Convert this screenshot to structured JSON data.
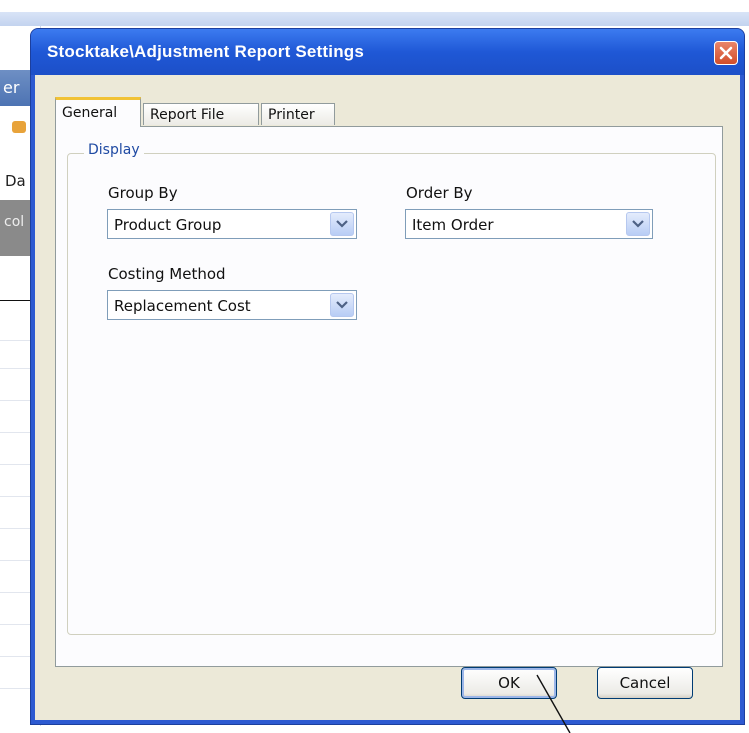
{
  "background_app": {
    "header_fragment": "er",
    "da_fragment": "Da",
    "col_fragment": "col"
  },
  "dialog": {
    "title": "Stocktake\\Adjustment Report Settings",
    "tabs": [
      {
        "label": "General",
        "active": true
      },
      {
        "label": "Report File",
        "active": false
      },
      {
        "label": "Printer",
        "active": false
      }
    ],
    "group_title": "Display",
    "fields": {
      "group_by": {
        "label": "Group By",
        "value": "Product Group"
      },
      "order_by": {
        "label": "Order By",
        "value": "Item Order"
      },
      "costing_method": {
        "label": "Costing Method",
        "value": "Replacement Cost"
      }
    },
    "buttons": {
      "ok": "OK",
      "cancel": "Cancel"
    }
  },
  "colors": {
    "title_bar": "#1f58d6",
    "dialog_face": "#ece9d8",
    "active_tab_accent": "#f1c235",
    "group_title": "#1f4aa3",
    "close_button": "#d24d2a"
  },
  "icons": [
    "close-icon",
    "dropdown-arrow-icon"
  ]
}
